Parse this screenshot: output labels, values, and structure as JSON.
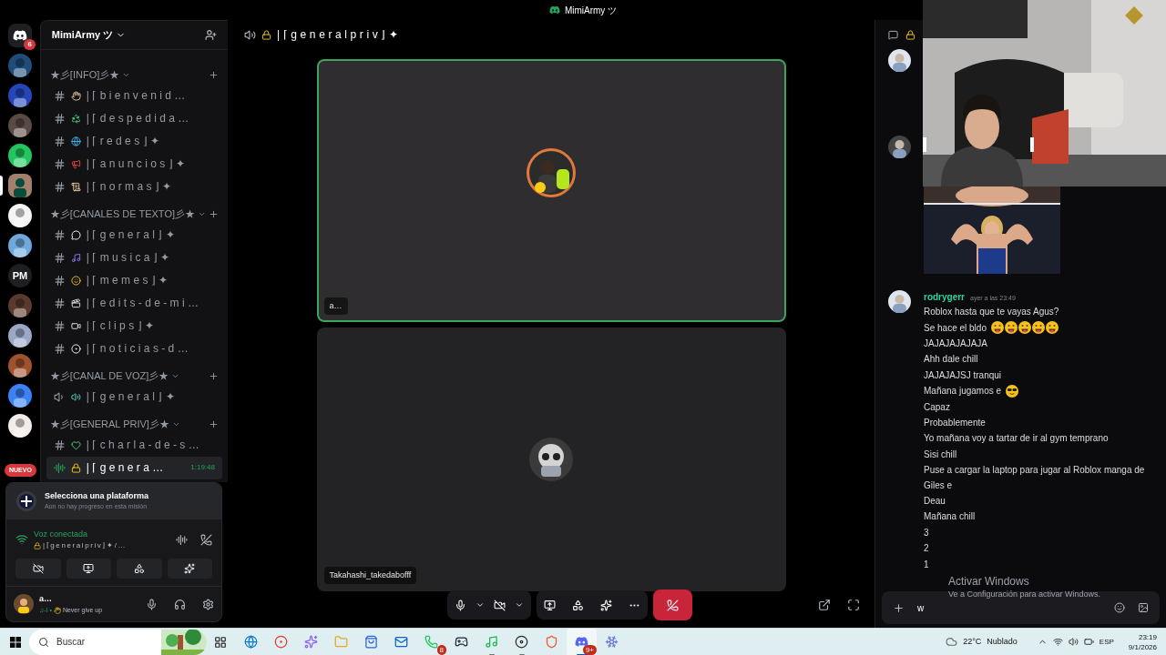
{
  "title_bar": {
    "title": "MimiArmy ツ"
  },
  "servers": [
    {
      "kind": "home",
      "badge": "6",
      "selected": false
    },
    {
      "kind": "picture",
      "selected": false
    },
    {
      "kind": "picture",
      "selected": false
    },
    {
      "kind": "picture",
      "selected": false
    },
    {
      "kind": "picture",
      "selected": false
    },
    {
      "kind": "picture",
      "selected": true
    },
    {
      "kind": "picture",
      "selected": false
    },
    {
      "kind": "picture",
      "selected": false
    },
    {
      "kind": "text",
      "label": "PM",
      "selected": false
    },
    {
      "kind": "picture",
      "selected": false
    },
    {
      "kind": "picture",
      "selected": false
    },
    {
      "kind": "picture",
      "selected": false
    },
    {
      "kind": "picture",
      "selected": false
    },
    {
      "kind": "picture",
      "selected": false
    }
  ],
  "new_badge": "NUEVO",
  "sidebar": {
    "server_name": "MimiArmy ツ",
    "categories": [
      {
        "name": "★彡[INFO]彡★",
        "channels": [
          {
            "kind": "text",
            "name": "|⌈bienvenid…",
            "selected": false
          },
          {
            "kind": "text",
            "name": "|⌈despedida…",
            "selected": false
          },
          {
            "kind": "text",
            "name": "|⌈redes⌋✦",
            "selected": false
          },
          {
            "kind": "text",
            "name": "|⌈anuncios⌋✦",
            "selected": false
          },
          {
            "kind": "text",
            "name": "|⌈normas⌋✦",
            "selected": false
          }
        ]
      },
      {
        "name": "★彡[CANALES DE TEXTO]彡★",
        "channels": [
          {
            "kind": "text",
            "name": "|⌈general⌋✦",
            "selected": false
          },
          {
            "kind": "text",
            "name": "|⌈musica⌋✦",
            "selected": false
          },
          {
            "kind": "text",
            "name": "|⌈memes⌋✦",
            "selected": false
          },
          {
            "kind": "text",
            "name": "|⌈edits-de-mi…",
            "selected": false
          },
          {
            "kind": "text",
            "name": "|⌈clips⌋✦",
            "selected": false
          },
          {
            "kind": "text",
            "name": "|⌈noticias-d…",
            "selected": false
          }
        ]
      },
      {
        "name": "★彡[CANAL DE VOZ]彡★",
        "channels": [
          {
            "kind": "voice",
            "name": "|⌈general⌋✦",
            "selected": false
          }
        ]
      },
      {
        "name": "★彡[GENERAL PRIV]彡★",
        "channels": [
          {
            "kind": "text",
            "name": "|⌈charla-de-s…",
            "selected": false
          },
          {
            "kind": "live",
            "name": "|⌈genera…",
            "timer": "1:19:48",
            "selected": true
          }
        ]
      }
    ]
  },
  "quest": {
    "title": "Selecciona una plataforma",
    "subtitle": "Aún no hay progreso en esta misión"
  },
  "voice_panel": {
    "status": "Voz conectada",
    "channel": "|⌈generalpriv⌋✦/…"
  },
  "user_panel": {
    "name": "a…",
    "activity_prefix": "♫-I •",
    "activity": "Never give up"
  },
  "voice": {
    "channel_title": "|⌈generalpriv⌋✦",
    "participants": [
      {
        "name": "a…",
        "speaking": true
      },
      {
        "name": "Takahashi_takedabofff",
        "speaking": false
      }
    ]
  },
  "chat": {
    "author": "rodrygerr",
    "time": "ayer a las 23:49",
    "lines": [
      {
        "text": "Roblox hasta que te vayas Agus?"
      },
      {
        "text": "Se hace el bldo",
        "emojis": [
          {
            "kind": "tongue"
          },
          {
            "kind": "tongue"
          },
          {
            "kind": "tongue"
          },
          {
            "kind": "tongue"
          },
          {
            "kind": "tongue"
          }
        ]
      },
      {
        "text": "JAJAJAJAJAJA"
      },
      {
        "text": "Ahh dale chill"
      },
      {
        "text": "JAJAJAJSJ tranqui"
      },
      {
        "text": "Mañana jugamos e",
        "emojis": [
          {
            "kind": "sunglasses"
          }
        ]
      },
      {
        "text": "Capaz"
      },
      {
        "text": "Probablemente"
      },
      {
        "text": "Yo mañana voy a tartar de ir al gym temprano"
      },
      {
        "text": "Sisi chill"
      },
      {
        "text": "Puse a cargar la laptop para jugar al Roblox manga de Giles e"
      },
      {
        "text": "Deau"
      },
      {
        "text": "Mañana chill"
      },
      {
        "text": "3"
      },
      {
        "text": "2"
      },
      {
        "text": "1"
      }
    ],
    "input": {
      "value": "w"
    }
  },
  "windows_activation": {
    "title": "Activar Windows",
    "subtitle": "Ve a Configuración para activar Windows."
  },
  "taskbar": {
    "search": {
      "placeholder": "Buscar"
    },
    "apps": [
      {
        "kind": "browser",
        "selected": false,
        "running": false
      },
      {
        "kind": "chrome",
        "selected": false,
        "running": false
      },
      {
        "kind": "copilot",
        "selected": false,
        "running": false
      },
      {
        "kind": "folder",
        "selected": false,
        "running": false
      },
      {
        "kind": "store",
        "selected": false,
        "running": false
      },
      {
        "kind": "mail",
        "selected": false,
        "running": false
      },
      {
        "kind": "chat",
        "badge": "8",
        "selected": false,
        "running": false
      },
      {
        "kind": "steam",
        "selected": false,
        "running": false
      },
      {
        "kind": "music",
        "selected": false,
        "running": true
      },
      {
        "kind": "record",
        "selected": false,
        "running": true
      },
      {
        "kind": "shield",
        "selected": false,
        "running": false
      },
      {
        "kind": "discord",
        "badge": "9+",
        "selected": true,
        "running": true
      },
      {
        "kind": "snowflake",
        "selected": false,
        "running": false
      }
    ],
    "temperature": "22°C",
    "weather": "Nublado",
    "language": "ESP",
    "time": "23:19",
    "date": "9/1/2026"
  }
}
